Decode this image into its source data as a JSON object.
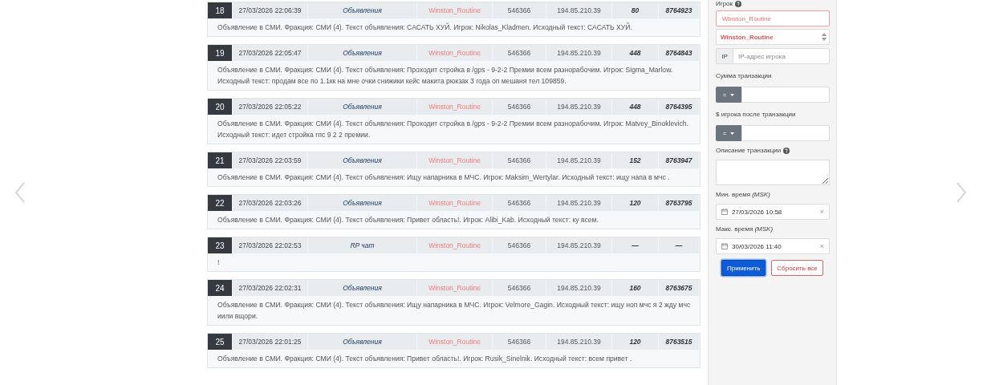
{
  "rows": [
    {
      "number": "18",
      "datetime": "27/03/2026 22:06:39",
      "type": "Объявления",
      "player": "Winston_Routine",
      "account_id": "546366",
      "ip": "194.85.210.39",
      "amount": "80",
      "transaction": "8764923",
      "message": "Объявление в СМИ. Фракция: СМИ (4). Текст объявления: САСАТЬ ХУЙ. Игрок: Nikolas_Kladmen. Исходный текст: САСАТЬ ХУЙ."
    },
    {
      "number": "19",
      "datetime": "27/03/2026 22:05:47",
      "type": "Объявления",
      "player": "Winston_Routine",
      "account_id": "546366",
      "ip": "194.85.210.39",
      "amount": "448",
      "transaction": "8764843",
      "message": "Объявление в СМИ. Фракция: СМИ (4). Текст объявления: Проходит стройка в /gps - 9-2-2 Премии всем разнорабочим. Игрок: Sigma_Marlow. Исходный текст: продам все по 1.1кк на мне очки снижики кейс макита рюкзак 3 года оп мешаня тел 109859."
    },
    {
      "number": "20",
      "datetime": "27/03/2026 22:05:22",
      "type": "Объявления",
      "player": "Winston_Routine",
      "account_id": "546366",
      "ip": "194.85.210.39",
      "amount": "448",
      "transaction": "8764395",
      "message": "Объявление в СМИ. Фракция: СМИ (4). Текст объявления: Проходит стройка в /gps - 9-2-2 Премии всем разнорабочим. Игрок: Matvey_Binoklevich. Исходный текст: идет стройка гпс 9 2 2 премии."
    },
    {
      "number": "21",
      "datetime": "27/03/2026 22:03:59",
      "type": "Объявления",
      "player": "Winston_Routine",
      "account_id": "546366",
      "ip": "194.85.210.39",
      "amount": "152",
      "transaction": "8763947",
      "message": "Объявление в СМИ. Фракция: СМИ (4). Текст объявления: Ищу напарника в МЧС. Игрок: Maksim_Wertylar. Исходный текст: ищу напа в мчс ."
    },
    {
      "number": "22",
      "datetime": "27/03/2026 22:03:26",
      "type": "Объявления",
      "player": "Winston_Routine",
      "account_id": "546366",
      "ip": "194.85.210.39",
      "amount": "120",
      "transaction": "8763795",
      "message": "Объявление в СМИ. Фракция: СМИ (4). Текст объявления: Привет область!. Игрок: Alibi_Kab. Исходный текст: ку всем."
    },
    {
      "number": "23",
      "datetime": "27/03/2026 22:02:53",
      "type": "RP чат",
      "player": "Winston_Routine",
      "account_id": "546366",
      "ip": "194.85.210.39",
      "amount": "—",
      "transaction": "—",
      "message": "!"
    },
    {
      "number": "24",
      "datetime": "27/03/2026 22:02:31",
      "type": "Объявления",
      "player": "Winston_Routine",
      "account_id": "546366",
      "ip": "194.85.210.39",
      "amount": "160",
      "transaction": "8763675",
      "message": "Объявление в СМИ. Фракция: СМИ (4). Текст объявления: Ищу напарника в МЧС. Игрок: Velmore_Gagin. Исходный текст: ищу ноп мчс я 2 жду мчс иили вщори."
    },
    {
      "number": "25",
      "datetime": "27/03/2026 22:01:25",
      "type": "Объявления",
      "player": "Winston_Routine",
      "account_id": "546366",
      "ip": "194.85.210.39",
      "amount": "120",
      "transaction": "8763515",
      "message": "Объявление в СМИ. Фракция: СМИ (4). Текст объявления: Привет область!. Игрок: Rusik_Sinelnik. Исходный текст: всем привет ."
    }
  ],
  "filters": [
    {
      "kind": "label",
      "text": "Игрок",
      "help": true
    },
    {
      "kind": "input",
      "value": "Winston_Routine",
      "highlighted": true
    },
    {
      "kind": "select",
      "value": "Winston_Routine"
    },
    {
      "kind": "addon-input",
      "addon": "IP",
      "placeholder": "IP-адрес игрока"
    },
    {
      "kind": "label",
      "text": "Сумма транзакции",
      "help": false
    },
    {
      "kind": "operator-input",
      "operator": "="
    },
    {
      "kind": "label",
      "text": "$ игрока после транзакции",
      "help": false
    },
    {
      "kind": "operator-input",
      "operator": "="
    },
    {
      "kind": "label",
      "text": "Описание транзакции",
      "help": true
    },
    {
      "kind": "textarea"
    },
    {
      "kind": "label",
      "text": "Мин. время *(MSK)*",
      "help": false
    },
    {
      "kind": "date",
      "value": "27/03/2026 10:58",
      "clear": "×"
    },
    {
      "kind": "label",
      "text": "Макс. время *(MSK)*",
      "help": false
    },
    {
      "kind": "date",
      "value": "30/03/2026 11:40",
      "clear": "×"
    },
    {
      "kind": "buttons",
      "buttons": [
        {
          "label": "Применить",
          "kind": "primary"
        },
        {
          "label": "Сбросить все",
          "kind": "outline"
        }
      ]
    }
  ]
}
